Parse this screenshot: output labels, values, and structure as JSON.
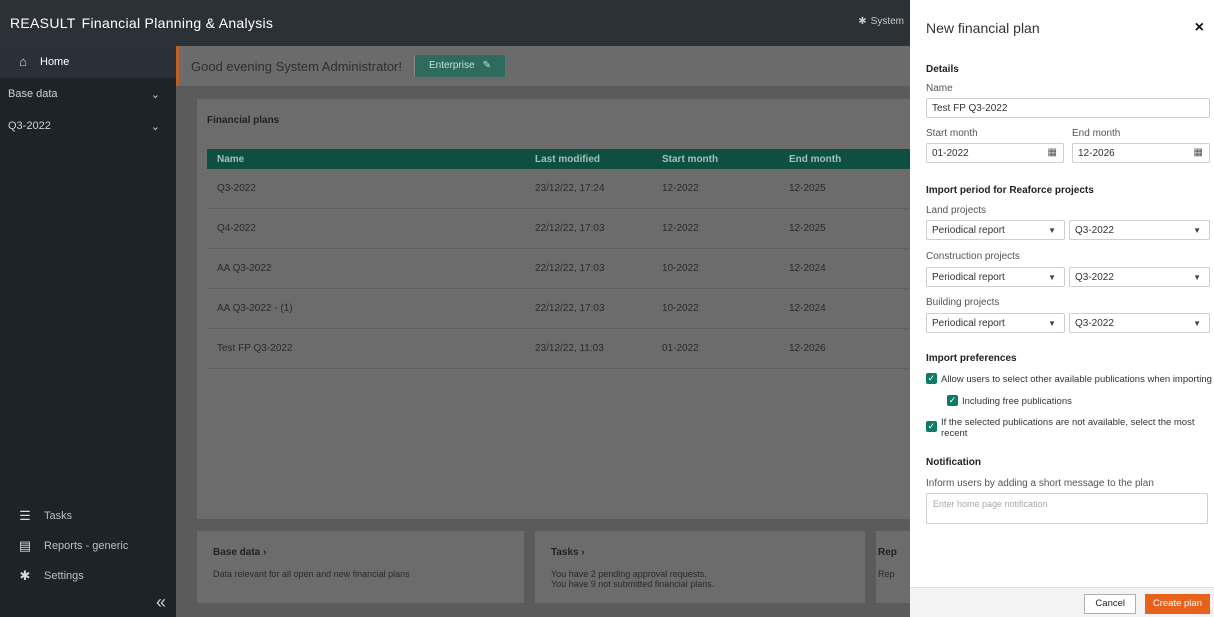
{
  "topbar": {
    "brand": "REASULT",
    "app_name": "Financial Planning & Analysis",
    "system_label": "System"
  },
  "sidebar": {
    "home": "Home",
    "groups": [
      "Base data",
      "Q3-2022"
    ],
    "bottom_items": [
      "Tasks",
      "Reports - generic",
      "Settings"
    ],
    "collapse_symbol": "«"
  },
  "greeting": {
    "text": "Good evening System Administrator!",
    "badge": "Enterprise"
  },
  "plans_card": {
    "title": "Financial plans",
    "columns": [
      "Name",
      "Last modified",
      "Start month",
      "End month"
    ],
    "rows": [
      [
        "Q3-2022",
        "23/12/22, 17:24",
        "12-2022",
        "12-2025"
      ],
      [
        "Q4-2022",
        "22/12/22, 17:03",
        "12-2022",
        "12-2025"
      ],
      [
        "AA Q3-2022",
        "22/12/22, 17:03",
        "10-2022",
        "12-2024"
      ],
      [
        "AA Q3-2022 - (1)",
        "22/12/22, 17:03",
        "10-2022",
        "12-2024"
      ],
      [
        "Test FP Q3-2022",
        "23/12/22, 11:03",
        "01-2022",
        "12-2026"
      ]
    ]
  },
  "mini_cards": [
    {
      "title": "Base data",
      "arrow": "›",
      "text1": "Data relevant for all open and new financial plans",
      "text2": ""
    },
    {
      "title": "Tasks",
      "arrow": "›",
      "text1": "You have 2 pending approval requests.",
      "text2": "You have 9 not submitted financial plans."
    },
    {
      "title": "Rep",
      "arrow": "",
      "text1": "Rep",
      "text2": ""
    }
  ],
  "panel": {
    "title": "New financial plan",
    "close": "×",
    "details_heading": "Details",
    "name_label": "Name",
    "name_value": "Test FP Q3-2022",
    "start_label": "Start month",
    "start_value": "01-2022",
    "end_label": "End month",
    "end_value": "12-2026",
    "import_heading": "Import period for Reaforce projects",
    "land_label": "Land projects",
    "construction_label": "Construction projects",
    "building_label": "Building projects",
    "report_value": "Periodical report",
    "period_value": "Q3-2022",
    "prefs_heading": "Import preferences",
    "pref1": "Allow users to select other available publications when importing",
    "pref2": "Including free publications",
    "pref3": "If the selected publications are not available, select the most recent",
    "notif_heading": "Notification",
    "notif_label": "Inform users by adding a short message to the plan",
    "notif_placeholder": "Enter home page notification",
    "cancel": "Cancel",
    "create": "Create plan"
  }
}
